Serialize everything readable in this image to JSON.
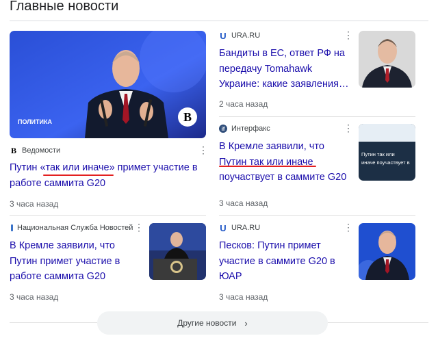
{
  "section_title": "Главные новости",
  "cards": {
    "main": {
      "image_badge": "ПОЛИТИКА",
      "image_logo": "B",
      "source_logo": "B",
      "source": "Ведомости",
      "headline": "Путин «так или иначе» примет участие в работе саммита G20",
      "time": "3 часа назад"
    },
    "ura1": {
      "source_logo": "U",
      "source": "URA.RU",
      "headline": "Бандиты в ЕС, ответ РФ на передачу Tomahawk Украине: какие заявления…",
      "time": "2 часа назад"
    },
    "interfax": {
      "source_logo": "if",
      "source": "Интерфакс",
      "headline": "В Кремле заявили, что Путин так или иначе поучаствует в саммите G20",
      "time": "3 часа назад",
      "thumb_text_1": "Путин так или",
      "thumb_text_2": "иначе поучаствует в"
    },
    "nsn": {
      "source": "Национальная Служба Новостей",
      "headline": "В Кремле заявили, что Путин примет участие в работе саммита G20",
      "time": "3 часа назад"
    },
    "ura2": {
      "source_logo": "U",
      "source": "URA.RU",
      "headline": "Песков: Путин примет участие в саммите G20 в ЮАР",
      "time": "3 часа назад"
    }
  },
  "more_button": {
    "label": "Другие новости"
  },
  "colors": {
    "link": "#1a0dab",
    "accent_red": "#e32020",
    "button_bg": "#f1f3f4"
  },
  "icons": [
    "more-vert-icon",
    "chevron-right-icon"
  ]
}
